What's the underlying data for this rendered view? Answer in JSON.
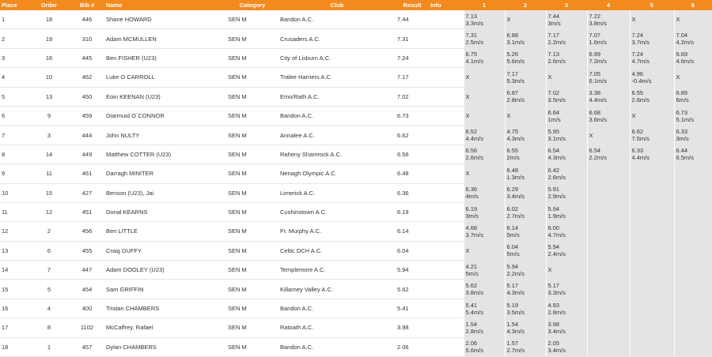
{
  "columns": [
    "Place",
    "Order",
    "Bib #",
    "Name",
    "Category",
    "Club",
    "Result",
    "Info",
    "1",
    "2",
    "3",
    "4",
    "5",
    "6"
  ],
  "rows": [
    {
      "place": "1",
      "order": "18",
      "bib": "446",
      "name": "Shane HOWARD",
      "category": "SEN M",
      "club": "Bandon A.C.",
      "result": "7.44",
      "info": "",
      "attempts": [
        {
          "mark": "7.13",
          "wind": "3.3m/s"
        },
        {
          "mark": "X",
          "wind": ""
        },
        {
          "mark": "7.44",
          "wind": "3m/s"
        },
        {
          "mark": "7.22",
          "wind": "3.8m/s"
        },
        {
          "mark": "X",
          "wind": ""
        },
        {
          "mark": "X",
          "wind": ""
        }
      ]
    },
    {
      "place": "2",
      "order": "19",
      "bib": "310",
      "name": "Adam MCMULLEN",
      "category": "SEN M",
      "club": "Crusaders A.C.",
      "result": "7.31",
      "info": "",
      "attempts": [
        {
          "mark": "7.31",
          "wind": "2.5m/s"
        },
        {
          "mark": "6.88",
          "wind": "3.1m/s"
        },
        {
          "mark": "7.17",
          "wind": "2.2m/s"
        },
        {
          "mark": "7.07",
          "wind": "1.6m/s"
        },
        {
          "mark": "7.24",
          "wind": "3.7m/s"
        },
        {
          "mark": "7.04",
          "wind": "4.2m/s"
        }
      ]
    },
    {
      "place": "3",
      "order": "16",
      "bib": "445",
      "name": "Ben FISHER (U23)",
      "category": "SEN M",
      "club": "City of Lisburn A.C.",
      "result": "7.24",
      "info": "",
      "attempts": [
        {
          "mark": "6.75",
          "wind": "4.1m/s"
        },
        {
          "mark": "5.26",
          "wind": "5.6m/s"
        },
        {
          "mark": "7.13",
          "wind": "2.6m/s"
        },
        {
          "mark": "6.99",
          "wind": "7.2m/s"
        },
        {
          "mark": "7.24",
          "wind": "4.7m/s"
        },
        {
          "mark": "6.69",
          "wind": "4.6m/s"
        }
      ]
    },
    {
      "place": "4",
      "order": "10",
      "bib": "462",
      "name": "Luke O CARROLL",
      "category": "SEN M",
      "club": "Tralee Harriers A.C.",
      "result": "7.17",
      "info": "",
      "attempts": [
        {
          "mark": "X",
          "wind": ""
        },
        {
          "mark": "7.17",
          "wind": "5.3m/s"
        },
        {
          "mark": "X",
          "wind": ""
        },
        {
          "mark": "7.05",
          "wind": "6.1m/s"
        },
        {
          "mark": "4.96",
          "wind": "-0.4m/s"
        },
        {
          "mark": "X",
          "wind": ""
        }
      ]
    },
    {
      "place": "5",
      "order": "13",
      "bib": "450",
      "name": "Eoin KEENAN (U23)",
      "category": "SEN M",
      "club": "Emo/Rath A.C.",
      "result": "7.02",
      "info": "",
      "attempts": [
        {
          "mark": "X",
          "wind": ""
        },
        {
          "mark": "6.87",
          "wind": "2.8m/s"
        },
        {
          "mark": "7.02",
          "wind": "3.5m/s"
        },
        {
          "mark": "3.38",
          "wind": "4.4m/s"
        },
        {
          "mark": "6.55",
          "wind": "2.6m/s"
        },
        {
          "mark": "6.89",
          "wind": "6m/s"
        }
      ]
    },
    {
      "place": "6",
      "order": "9",
      "bib": "459",
      "name": "Diarmuid O`CONNOR",
      "category": "SEN M",
      "club": "Bandon A.C.",
      "result": "6.73",
      "info": "",
      "attempts": [
        {
          "mark": "X",
          "wind": ""
        },
        {
          "mark": "X",
          "wind": ""
        },
        {
          "mark": "6.64",
          "wind": "1m/s"
        },
        {
          "mark": "6.68",
          "wind": "3.6m/s"
        },
        {
          "mark": "X",
          "wind": ""
        },
        {
          "mark": "6.73",
          "wind": "5.1m/s"
        }
      ]
    },
    {
      "place": "7",
      "order": "3",
      "bib": "444",
      "name": "John NULTY",
      "category": "SEN M",
      "club": "Annalee A.C.",
      "result": "6.62",
      "info": "",
      "attempts": [
        {
          "mark": "6.52",
          "wind": "4.4m/s"
        },
        {
          "mark": "4.75",
          "wind": "4.3m/s"
        },
        {
          "mark": "5.95",
          "wind": "3.1m/s"
        },
        {
          "mark": "X",
          "wind": ""
        },
        {
          "mark": "6.62",
          "wind": "7.5m/s"
        },
        {
          "mark": "6.33",
          "wind": "3m/s"
        }
      ]
    },
    {
      "place": "8",
      "order": "14",
      "bib": "449",
      "name": "Matthew COTTER (U23)",
      "category": "SEN M",
      "club": "Raheny Shamrock A.C.",
      "result": "6.56",
      "info": "",
      "attempts": [
        {
          "mark": "6.56",
          "wind": "2.6m/s"
        },
        {
          "mark": "6.55",
          "wind": "2m/s"
        },
        {
          "mark": "6.54",
          "wind": "4.3m/s"
        },
        {
          "mark": "6.54",
          "wind": "2.2m/s"
        },
        {
          "mark": "6.33",
          "wind": "4.4m/s"
        },
        {
          "mark": "6.44",
          "wind": "6.5m/s"
        }
      ]
    },
    {
      "place": "9",
      "order": "11",
      "bib": "461",
      "name": "Darragh MINITER",
      "category": "SEN M",
      "club": "Nenagh Olympic A.C.",
      "result": "6.48",
      "info": "",
      "attempts": [
        {
          "mark": "X",
          "wind": ""
        },
        {
          "mark": "6.48",
          "wind": "1.3m/s"
        },
        {
          "mark": "6.42",
          "wind": "2.6m/s"
        }
      ]
    },
    {
      "place": "10",
      "order": "15",
      "bib": "427",
      "name": "Benson (U23), Jai",
      "category": "SEN M",
      "club": "Limerick A.C.",
      "result": "6.36",
      "info": "",
      "attempts": [
        {
          "mark": "6.36",
          "wind": "4m/s"
        },
        {
          "mark": "6.29",
          "wind": "3.4m/s"
        },
        {
          "mark": "5.91",
          "wind": "2.9m/s"
        }
      ]
    },
    {
      "place": "11",
      "order": "12",
      "bib": "451",
      "name": "Donal KEARNS",
      "category": "SEN M",
      "club": "Cushinstown A.C.",
      "result": "6.19",
      "info": "",
      "attempts": [
        {
          "mark": "6.19",
          "wind": "3m/s"
        },
        {
          "mark": "6.02",
          "wind": "2.7m/s"
        },
        {
          "mark": "5.94",
          "wind": "1.9m/s"
        }
      ]
    },
    {
      "place": "12",
      "order": "2",
      "bib": "456",
      "name": "Ben LITTLE",
      "category": "SEN M",
      "club": "Fr. Murphy A.C.",
      "result": "6.14",
      "info": "",
      "attempts": [
        {
          "mark": "4.68",
          "wind": "3.7m/s"
        },
        {
          "mark": "6.14",
          "wind": "5m/s"
        },
        {
          "mark": "6.00",
          "wind": "4.7m/s"
        }
      ]
    },
    {
      "place": "13",
      "order": "6",
      "bib": "455",
      "name": "Craig DUFFY",
      "category": "SEN M",
      "club": "Celtic DCH A.C.",
      "result": "6.04",
      "info": "",
      "attempts": [
        {
          "mark": "X",
          "wind": ""
        },
        {
          "mark": "6.04",
          "wind": "5m/s"
        },
        {
          "mark": "5.94",
          "wind": "2.4m/s"
        }
      ]
    },
    {
      "place": "14",
      "order": "7",
      "bib": "447",
      "name": "Adam DOOLEY (U23)",
      "category": "SEN M",
      "club": "Templemore A.C.",
      "result": "5.94",
      "info": "",
      "attempts": [
        {
          "mark": "4.21",
          "wind": "5m/s"
        },
        {
          "mark": "5.94",
          "wind": "2.2m/s"
        },
        {
          "mark": "X",
          "wind": ""
        }
      ]
    },
    {
      "place": "15",
      "order": "5",
      "bib": "454",
      "name": "Sam GRIFFIN",
      "category": "SEN M",
      "club": "Killarney Valley A.C.",
      "result": "5.62",
      "info": "",
      "attempts": [
        {
          "mark": "5.62",
          "wind": "3.8m/s"
        },
        {
          "mark": "5.17",
          "wind": "4.3m/s"
        },
        {
          "mark": "5.17",
          "wind": "3.3m/s"
        }
      ]
    },
    {
      "place": "16",
      "order": "4",
      "bib": "400",
      "name": "Tristan CHAMBERS",
      "category": "SEN M",
      "club": "Bandon A.C.",
      "result": "5.41",
      "info": "",
      "attempts": [
        {
          "mark": "5.41",
          "wind": "5.4m/s"
        },
        {
          "mark": "5.19",
          "wind": "3.5m/s"
        },
        {
          "mark": "4.93",
          "wind": "2.8m/s"
        }
      ]
    },
    {
      "place": "17",
      "order": "8",
      "bib": "1102",
      "name": "McCaffrey, Rafael",
      "category": "SEN M",
      "club": "Ratoath A.C.",
      "result": "3.98",
      "info": "",
      "attempts": [
        {
          "mark": "1.54",
          "wind": "2.8m/s"
        },
        {
          "mark": "1.54",
          "wind": "4.3m/s"
        },
        {
          "mark": "3.98",
          "wind": "3.4m/s"
        }
      ]
    },
    {
      "place": "18",
      "order": "1",
      "bib": "457",
      "name": "Dylan CHAMBERS",
      "category": "SEN M",
      "club": "Bandon A.C.",
      "result": "2.06",
      "info": "",
      "attempts": [
        {
          "mark": "2.06",
          "wind": "5.6m/s"
        },
        {
          "mark": "1.57",
          "wind": "2.7m/s"
        },
        {
          "mark": "2.05",
          "wind": "3.4m/s"
        }
      ]
    }
  ]
}
